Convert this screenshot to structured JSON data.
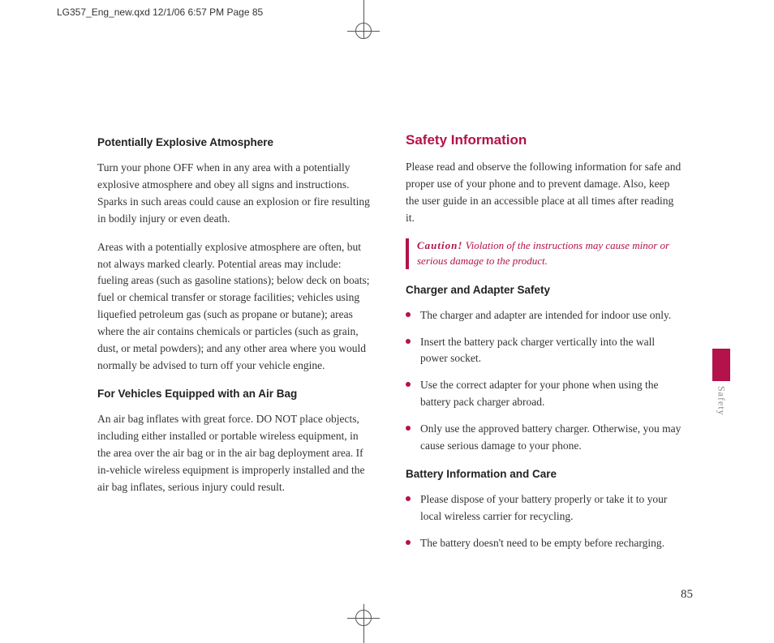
{
  "runhead": "LG357_Eng_new.qxd  12/1/06  6:57 PM  Page 85",
  "left": {
    "h1": "Potentially Explosive Atmosphere",
    "p1": "Turn your phone OFF when in any area with a potentially explosive atmosphere and obey all signs and instructions. Sparks in such areas could cause an explosion or fire resulting in bodily injury or even death.",
    "p2": "Areas with a potentially explosive atmosphere are often, but not always marked clearly. Potential areas may include: fueling areas (such as gasoline stations); below deck on boats; fuel or chemical transfer or storage facilities; vehicles using liquefied petroleum gas (such as propane or butane); areas where the air contains chemicals or particles (such as grain, dust, or metal powders); and any other area where you would normally be advised to turn off your vehicle engine.",
    "h2": "For Vehicles Equipped with an Air Bag",
    "p3": "An air bag inflates with great force. DO NOT place objects, including either installed or portable wireless equipment, in the area over the air bag or in the air bag deployment area. If in-vehicle wireless equipment is improperly installed and the air bag inflates, serious injury could result."
  },
  "right": {
    "title": "Safety Information",
    "intro": "Please read and observe the following information for safe and proper use of your phone and to prevent damage. Also, keep the user guide in an accessible place at all times after reading it.",
    "caution_label": "Caution!",
    "caution_text": " Violation of the instructions may cause minor or serious damage to the product.",
    "h_charger": "Charger and Adapter Safety",
    "charger": [
      "The charger and adapter are intended for indoor use only.",
      "Insert the battery pack charger vertically into the wall power socket.",
      "Use the correct adapter for your phone when using the battery pack charger abroad.",
      "Only use the approved battery charger. Otherwise, you may cause serious damage to your phone."
    ],
    "h_battery": "Battery Information and Care",
    "battery": [
      "Please dispose of your battery properly or take it to your local wireless carrier for recycling.",
      "The battery doesn't need to be empty before recharging."
    ]
  },
  "tab": "Safety",
  "page_number": "85"
}
